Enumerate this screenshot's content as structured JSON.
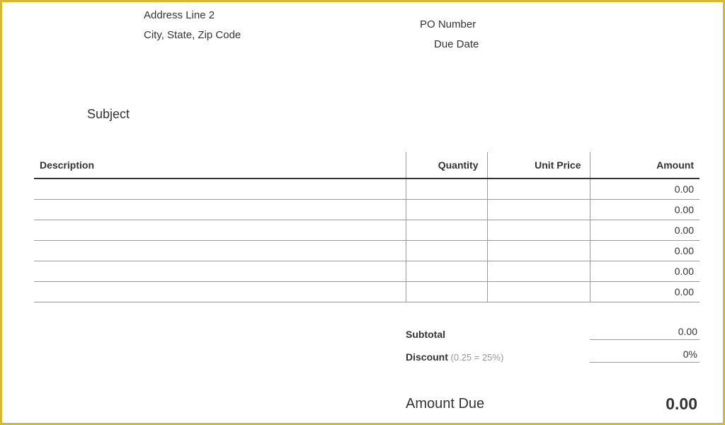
{
  "header": {
    "address_line_2": "Address Line 2",
    "city_state_zip": "City, State, Zip Code",
    "po_number_label": "PO Number",
    "due_date_label": "Due Date"
  },
  "subject_label": "Subject",
  "table": {
    "headers": {
      "description": "Description",
      "quantity": "Quantity",
      "unit_price": "Unit Price",
      "amount": "Amount"
    },
    "rows": [
      {
        "description": "",
        "quantity": "",
        "unit_price": "",
        "amount": "0.00"
      },
      {
        "description": "",
        "quantity": "",
        "unit_price": "",
        "amount": "0.00"
      },
      {
        "description": "",
        "quantity": "",
        "unit_price": "",
        "amount": "0.00"
      },
      {
        "description": "",
        "quantity": "",
        "unit_price": "",
        "amount": "0.00"
      },
      {
        "description": "",
        "quantity": "",
        "unit_price": "",
        "amount": "0.00"
      },
      {
        "description": "",
        "quantity": "",
        "unit_price": "",
        "amount": "0.00"
      }
    ]
  },
  "summary": {
    "subtotal_label": "Subtotal",
    "subtotal_value": "0.00",
    "discount_label": "Discount",
    "discount_hint": " (0.25 = 25%)",
    "discount_value": "0%",
    "amount_due_label": "Amount Due",
    "amount_due_value": "0.00"
  }
}
